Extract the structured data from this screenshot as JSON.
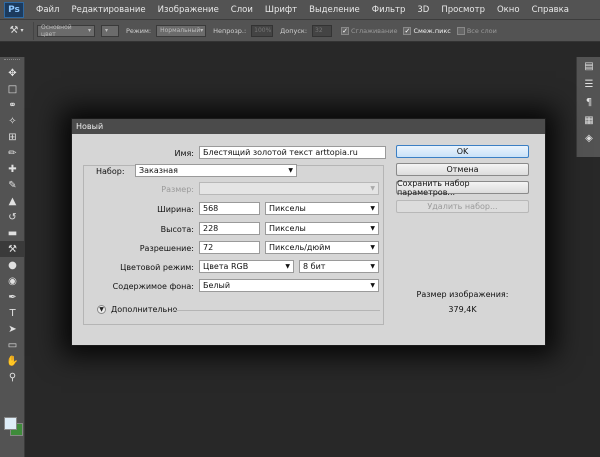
{
  "app": {
    "logo": "Ps"
  },
  "menu": [
    "Файл",
    "Редактирование",
    "Изображение",
    "Слои",
    "Шрифт",
    "Выделение",
    "Фильтр",
    "3D",
    "Просмотр",
    "Окно",
    "Справка"
  ],
  "options_bar": {
    "tool_preset_icon": "paint-bucket-icon",
    "fill_source": "Основной цвет",
    "mode_label": "Режим:",
    "mode_value": "Нормальный",
    "opacity_label": "Непрозр.:",
    "opacity_value": "100%",
    "tolerance_label": "Допуск:",
    "tolerance_value": "32",
    "anti_alias_label": "Сглаживание",
    "contiguous_label": "Смеж.пикс",
    "all_layers_label": "Все слои"
  },
  "toolbar": {
    "tools": [
      "move-icon",
      "marquee-icon",
      "lasso-icon",
      "quick-select-icon",
      "crop-icon",
      "eyedropper-icon",
      "healing-icon",
      "brush-icon",
      "stamp-icon",
      "history-brush-icon",
      "eraser-icon",
      "paint-bucket-icon",
      "blur-icon",
      "dodge-icon",
      "pen-icon",
      "type-icon",
      "path-select-icon",
      "shape-icon",
      "hand-icon",
      "zoom-icon"
    ],
    "foreground_color": "#dfeef8",
    "background_color": "#3e8b3a"
  },
  "dialog": {
    "title": "Новый",
    "name_label": "Имя:",
    "name_value": "Блестящий золотой текст  arttopia.ru",
    "preset_label": "Набор:",
    "preset_value": "Заказная",
    "size_label": "Размер:",
    "size_value": "",
    "width_label": "Ширина:",
    "width_value": "568",
    "width_unit": "Пикселы",
    "height_label": "Высота:",
    "height_value": "228",
    "height_unit": "Пикселы",
    "resolution_label": "Разрешение:",
    "resolution_value": "72",
    "resolution_unit": "Пиксель/дюйм",
    "color_mode_label": "Цветовой режим:",
    "color_mode_value": "Цвета RGB",
    "bit_depth_value": "8 бит",
    "background_label": "Содержимое фона:",
    "background_value": "Белый",
    "advanced_label": "Дополнительно",
    "ok_label": "OK",
    "cancel_label": "Отмена",
    "save_preset_label": "Сохранить набор параметров...",
    "delete_preset_label": "Удалить набор...",
    "image_size_label": "Размер изображения:",
    "image_size_value": "379,4K"
  }
}
